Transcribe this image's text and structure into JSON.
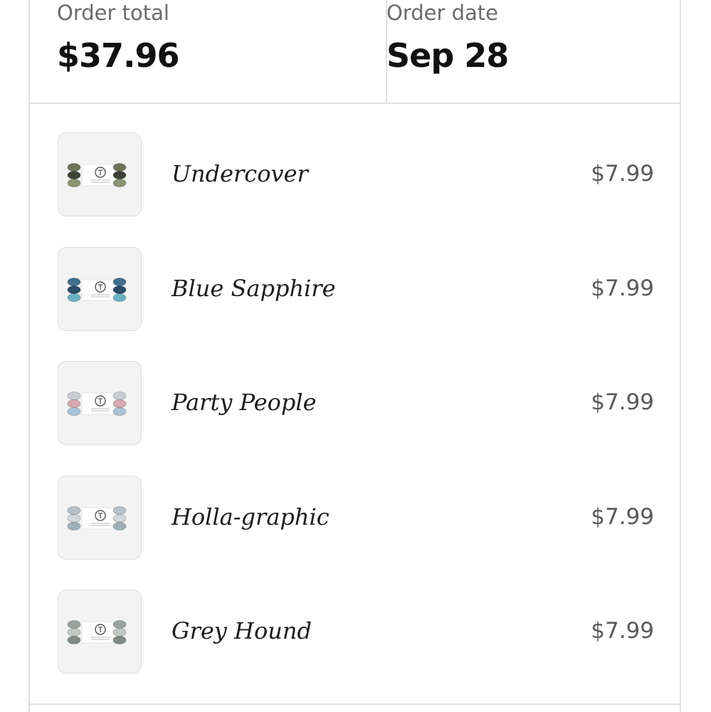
{
  "summary": {
    "total_label": "Order total",
    "total_value": "$37.96",
    "date_label": "Order date",
    "date_value": "Sep 28"
  },
  "items": [
    {
      "name": "Undercover",
      "price": "$7.99",
      "colors": [
        "#6f7558",
        "#3e4336",
        "#8b9470"
      ]
    },
    {
      "name": "Blue Sapphire",
      "price": "$7.99",
      "colors": [
        "#3f6f8f",
        "#2a4d66",
        "#68b2c4"
      ]
    },
    {
      "name": "Party People",
      "price": "$7.99",
      "colors": [
        "#c9cdd2",
        "#d8a8b3",
        "#a9c3d6"
      ]
    },
    {
      "name": "Holla-graphic",
      "price": "$7.99",
      "colors": [
        "#b7c1c7",
        "#d2d7da",
        "#9fb0b8"
      ]
    },
    {
      "name": "Grey Hound",
      "price": "$7.99",
      "colors": [
        "#9aa39d",
        "#c2c8c3",
        "#7f8a83"
      ]
    }
  ]
}
